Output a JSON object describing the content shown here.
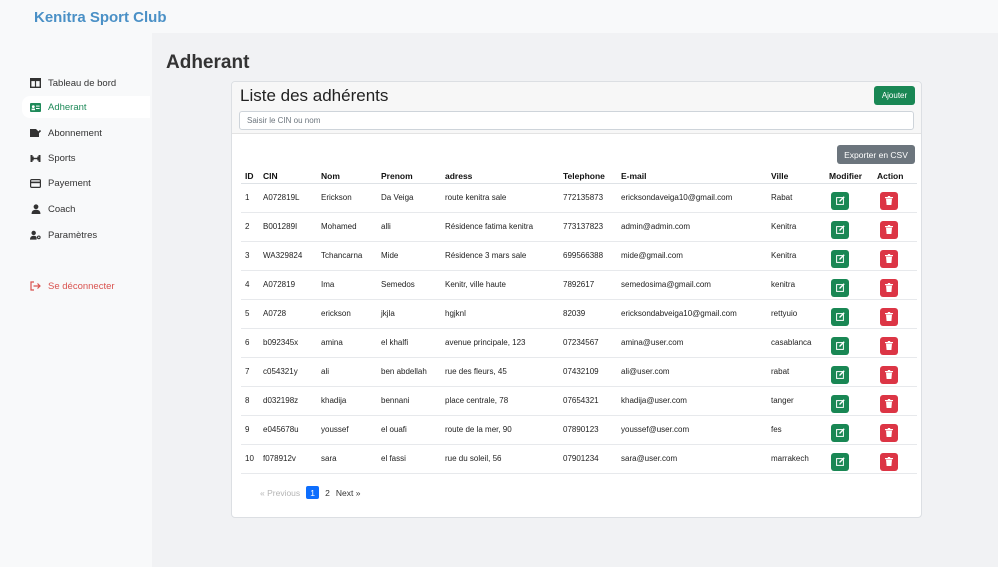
{
  "app": {
    "brand": "Kenitra Sport Club"
  },
  "sidebar": {
    "items": [
      {
        "label": "Tableau de bord",
        "icon": "table-icon"
      },
      {
        "label": "Adherant",
        "icon": "id-card-icon"
      },
      {
        "label": "Abonnement",
        "icon": "signature-icon"
      },
      {
        "label": "Sports",
        "icon": "dumbbell-icon"
      },
      {
        "label": "Payement",
        "icon": "credit-card-icon"
      },
      {
        "label": "Coach",
        "icon": "user-icon"
      },
      {
        "label": "Paramètres",
        "icon": "user-gear-icon"
      }
    ],
    "logout": {
      "label": "Se déconnecter",
      "icon": "logout-icon"
    }
  },
  "page": {
    "title": "Adherant"
  },
  "card": {
    "title": "Liste des adhérents",
    "add_label": "Ajouter",
    "search_placeholder": "Saisir le CIN ou nom",
    "export_label": "Exporter en CSV"
  },
  "table": {
    "headers": [
      "ID",
      "CIN",
      "Nom",
      "Prenom",
      "adress",
      "Telephone",
      "E-mail",
      "Ville",
      "Modifier",
      "Action"
    ],
    "rows": [
      [
        "1",
        "A072819L",
        "Erickson",
        "Da Veiga",
        "route kenitra sale",
        "772135873",
        "ericksondaveiga10@gmail.com",
        "Rabat"
      ],
      [
        "2",
        "B001289I",
        "Mohamed",
        "alli",
        "Résidence fatima kenitra",
        "773137823",
        "admin@admin.com",
        "Kenitra"
      ],
      [
        "3",
        "WA329824",
        "Tchancarna",
        "Mide",
        "Résidence 3 mars sale",
        "699566388",
        "mide@gmail.com",
        "Kenitra"
      ],
      [
        "4",
        "A072819",
        "Ima",
        "Semedos",
        "Kenitr, ville haute",
        "7892617",
        "semedosima@gmail.com",
        "kenitra"
      ],
      [
        "5",
        "A0728",
        "erickson",
        "jkjla",
        "hgjknl",
        "82039",
        "ericksondabveiga10@gmail.com",
        "rettyuio"
      ],
      [
        "6",
        "b092345x",
        "amina",
        "el khalfi",
        "avenue principale, 123",
        "07234567",
        "amina@user.com",
        "casablanca"
      ],
      [
        "7",
        "c054321y",
        "ali",
        "ben abdellah",
        "rue des fleurs, 45",
        "07432109",
        "ali@user.com",
        "rabat"
      ],
      [
        "8",
        "d032198z",
        "khadija",
        "bennani",
        "place centrale, 78",
        "07654321",
        "khadija@user.com",
        "tanger"
      ],
      [
        "9",
        "e045678u",
        "youssef",
        "el ouafi",
        "route de la mer, 90",
        "07890123",
        "youssef@user.com",
        "fes"
      ],
      [
        "10",
        "f078912v",
        "sara",
        "el fassi",
        "rue du soleil, 56",
        "07901234",
        "sara@user.com",
        "marrakech"
      ]
    ]
  },
  "pagination": {
    "prev": "« Previous",
    "pages": [
      "1",
      "2"
    ],
    "current": "1",
    "next": "Next »"
  },
  "colors": {
    "brand": "#4a90c6",
    "success": "#198754",
    "danger": "#dc3545",
    "secondary": "#6c757d",
    "primary": "#0d6efd"
  }
}
